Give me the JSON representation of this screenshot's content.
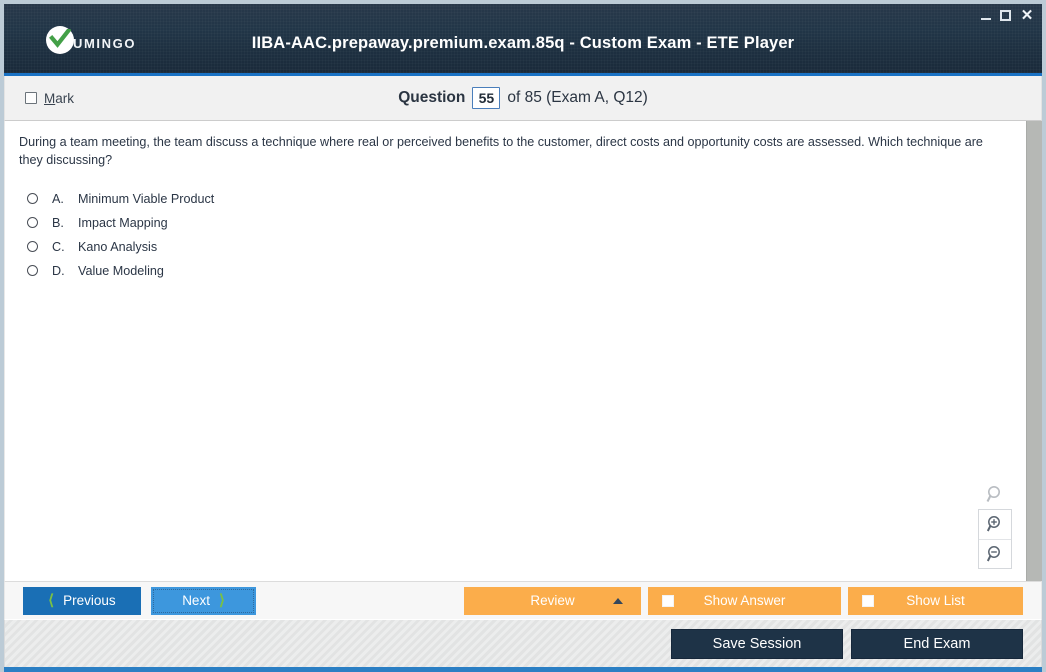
{
  "window": {
    "title": "IIBA-AAC.prepaway.premium.exam.85q - Custom Exam - ETE Player",
    "brand_name": "UMINGO",
    "brand_icon": "check-circle-icon",
    "controls": {
      "minimize": "minimize-icon",
      "maximize": "maximize-icon",
      "close": "close-icon"
    },
    "colors": {
      "titlebar": "#223648",
      "accent_blue": "#1a72c4",
      "orange": "#fbad4b",
      "navy_button": "#1e3347",
      "primary_button": "#1a6fb5",
      "secondary_button": "#3d97dd",
      "chevron_green": "#7ac143"
    }
  },
  "question_bar": {
    "mark_label_pre": "",
    "mark_label": "Mark",
    "mark_accel": "M",
    "mark_rest": "ark",
    "mark_checked": false,
    "question_word": "Question",
    "question_number": "55",
    "of_text": "of 85 (Exam A, Q12)"
  },
  "question": {
    "text": "During a team meeting, the team discuss a technique where real or perceived benefits to the customer, direct costs and opportunity costs are assessed. Which technique are they discussing?",
    "choices": [
      {
        "letter": "A.",
        "text": "Minimum Viable Product",
        "selected": false
      },
      {
        "letter": "B.",
        "text": "Impact Mapping",
        "selected": false
      },
      {
        "letter": "C.",
        "text": "Kano Analysis",
        "selected": false
      },
      {
        "letter": "D.",
        "text": "Value Modeling",
        "selected": false
      }
    ]
  },
  "zoom_tools": [
    {
      "name": "magnifier-icon",
      "label": ""
    },
    {
      "name": "zoom-in-icon",
      "label": ""
    },
    {
      "name": "zoom-out-icon",
      "label": ""
    }
  ],
  "nav_bar": {
    "previous_label": "Previous",
    "next_label": "Next",
    "review_label": "Review",
    "show_answer_label": "Show Answer",
    "show_list_label": "Show List",
    "show_answer_checked": false,
    "show_list_checked": false
  },
  "status_bar": {
    "save_session_label": "Save Session",
    "end_exam_label": "End Exam"
  }
}
